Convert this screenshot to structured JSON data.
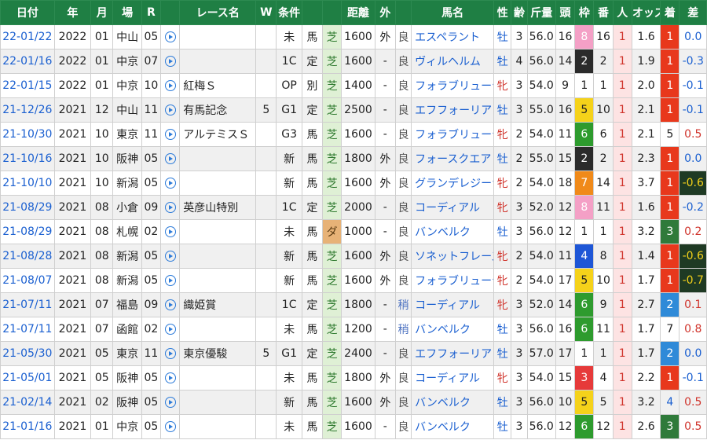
{
  "headers": [
    "日付",
    "年",
    "月",
    "場",
    "R",
    "",
    "レース名",
    "W",
    "条件",
    "",
    "",
    "距離",
    "外",
    "",
    "馬名",
    "性",
    "齢",
    "斤量",
    "頭",
    "枠",
    "番",
    "人",
    "オッズ",
    "着",
    "差"
  ],
  "rows": [
    {
      "date": "22-01/22",
      "year": "2022",
      "month": "01",
      "venue": "中山",
      "r": "05",
      "race": "",
      "w": "",
      "cond": "未",
      "cond2": "馬",
      "surface": "芝",
      "dist": "1600",
      "out": "外",
      "track": "良",
      "horse": "エスペラント",
      "sex": "牡",
      "age": "3",
      "weight": "56.0",
      "heads": "16",
      "frame": "8",
      "num": "16",
      "pop": "1",
      "odds": "1.6",
      "rank": "1",
      "diff": "0.0"
    },
    {
      "date": "22-01/16",
      "year": "2022",
      "month": "01",
      "venue": "中京",
      "r": "07",
      "race": "",
      "w": "",
      "cond": "1C",
      "cond2": "定",
      "surface": "芝",
      "dist": "1600",
      "out": "-",
      "track": "良",
      "horse": "ヴィルヘルム",
      "sex": "牡",
      "age": "4",
      "weight": "56.0",
      "heads": "14",
      "frame": "2",
      "num": "2",
      "pop": "1",
      "odds": "1.9",
      "rank": "1",
      "diff": "-0.3"
    },
    {
      "date": "22-01/15",
      "year": "2022",
      "month": "01",
      "venue": "中京",
      "r": "10",
      "race": "紅梅Ｓ",
      "w": "",
      "cond": "OP",
      "cond2": "別",
      "surface": "芝",
      "dist": "1400",
      "out": "-",
      "track": "良",
      "horse": "フォラブリューテ",
      "sex": "牝",
      "age": "3",
      "weight": "54.0",
      "heads": "9",
      "frame": "1",
      "num": "1",
      "pop": "1",
      "odds": "2.0",
      "rank": "1",
      "diff": "-0.1"
    },
    {
      "date": "21-12/26",
      "year": "2021",
      "month": "12",
      "venue": "中山",
      "r": "11",
      "race": "有馬記念",
      "w": "5",
      "cond": "G1",
      "cond2": "定",
      "surface": "芝",
      "dist": "2500",
      "out": "-",
      "track": "良",
      "horse": "エフフォーリア",
      "sex": "牡",
      "age": "3",
      "weight": "55.0",
      "heads": "16",
      "frame": "5",
      "num": "10",
      "pop": "1",
      "odds": "2.1",
      "rank": "1",
      "diff": "-0.1"
    },
    {
      "date": "21-10/30",
      "year": "2021",
      "month": "10",
      "venue": "東京",
      "r": "11",
      "race": "アルテミスＳ",
      "w": "",
      "cond": "G3",
      "cond2": "馬",
      "surface": "芝",
      "dist": "1600",
      "out": "-",
      "track": "良",
      "horse": "フォラブリューテ",
      "sex": "牝",
      "age": "2",
      "weight": "54.0",
      "heads": "11",
      "frame": "6",
      "num": "6",
      "pop": "1",
      "odds": "2.1",
      "rank": "5",
      "diff": "0.5"
    },
    {
      "date": "21-10/16",
      "year": "2021",
      "month": "10",
      "venue": "阪神",
      "r": "05",
      "race": "",
      "w": "",
      "cond": "新",
      "cond2": "馬",
      "surface": "芝",
      "dist": "1800",
      "out": "外",
      "track": "良",
      "horse": "フォースクエア",
      "sex": "牡",
      "age": "2",
      "weight": "55.0",
      "heads": "15",
      "frame": "2",
      "num": "2",
      "pop": "1",
      "odds": "2.3",
      "rank": "1",
      "diff": "0.0"
    },
    {
      "date": "21-10/10",
      "year": "2021",
      "month": "10",
      "venue": "新潟",
      "r": "05",
      "race": "",
      "w": "",
      "cond": "新",
      "cond2": "馬",
      "surface": "芝",
      "dist": "1600",
      "out": "外",
      "track": "良",
      "horse": "グランデレジーナ",
      "sex": "牝",
      "age": "2",
      "weight": "54.0",
      "heads": "18",
      "frame": "7",
      "num": "14",
      "pop": "1",
      "odds": "3.7",
      "rank": "1",
      "diff": "-0.6"
    },
    {
      "date": "21-08/29",
      "year": "2021",
      "month": "08",
      "venue": "小倉",
      "r": "09",
      "race": "英彦山特別",
      "w": "",
      "cond": "1C",
      "cond2": "定",
      "surface": "芝",
      "dist": "2000",
      "out": "-",
      "track": "良",
      "horse": "コーディアル",
      "sex": "牝",
      "age": "3",
      "weight": "52.0",
      "heads": "12",
      "frame": "8",
      "num": "11",
      "pop": "1",
      "odds": "1.6",
      "rank": "1",
      "diff": "-0.2"
    },
    {
      "date": "21-08/29",
      "year": "2021",
      "month": "08",
      "venue": "札幌",
      "r": "02",
      "race": "",
      "w": "",
      "cond": "未",
      "cond2": "馬",
      "surface": "ダ",
      "dist": "1000",
      "out": "-",
      "track": "良",
      "horse": "バンベルク",
      "sex": "牡",
      "age": "3",
      "weight": "56.0",
      "heads": "12",
      "frame": "1",
      "num": "1",
      "pop": "1",
      "odds": "3.2",
      "rank": "3",
      "diff": "0.2"
    },
    {
      "date": "21-08/28",
      "year": "2021",
      "month": "08",
      "venue": "新潟",
      "r": "05",
      "race": "",
      "w": "",
      "cond": "新",
      "cond2": "馬",
      "surface": "芝",
      "dist": "1600",
      "out": "外",
      "track": "良",
      "horse": "ソネットフレーズ",
      "sex": "牝",
      "age": "2",
      "weight": "54.0",
      "heads": "11",
      "frame": "4",
      "num": "8",
      "pop": "1",
      "odds": "1.4",
      "rank": "1",
      "diff": "-0.6"
    },
    {
      "date": "21-08/07",
      "year": "2021",
      "month": "08",
      "venue": "新潟",
      "r": "05",
      "race": "",
      "w": "",
      "cond": "新",
      "cond2": "馬",
      "surface": "芝",
      "dist": "1600",
      "out": "外",
      "track": "良",
      "horse": "フォラブリューテ",
      "sex": "牝",
      "age": "2",
      "weight": "54.0",
      "heads": "17",
      "frame": "5",
      "num": "10",
      "pop": "1",
      "odds": "1.7",
      "rank": "1",
      "diff": "-0.7"
    },
    {
      "date": "21-07/11",
      "year": "2021",
      "month": "07",
      "venue": "福島",
      "r": "09",
      "race": "織姫賞",
      "w": "",
      "cond": "1C",
      "cond2": "定",
      "surface": "芝",
      "dist": "1800",
      "out": "-",
      "track": "稍",
      "horse": "コーディアル",
      "sex": "牝",
      "age": "3",
      "weight": "52.0",
      "heads": "14",
      "frame": "6",
      "num": "9",
      "pop": "1",
      "odds": "2.7",
      "rank": "2",
      "diff": "0.1"
    },
    {
      "date": "21-07/11",
      "year": "2021",
      "month": "07",
      "venue": "函館",
      "r": "02",
      "race": "",
      "w": "",
      "cond": "未",
      "cond2": "馬",
      "surface": "芝",
      "dist": "1200",
      "out": "-",
      "track": "稍",
      "horse": "バンベルク",
      "sex": "牡",
      "age": "3",
      "weight": "56.0",
      "heads": "16",
      "frame": "6",
      "num": "11",
      "pop": "1",
      "odds": "1.7",
      "rank": "7",
      "diff": "0.8"
    },
    {
      "date": "21-05/30",
      "year": "2021",
      "month": "05",
      "venue": "東京",
      "r": "11",
      "race": "東京優駿",
      "w": "5",
      "cond": "G1",
      "cond2": "定",
      "surface": "芝",
      "dist": "2400",
      "out": "-",
      "track": "良",
      "horse": "エフフォーリア",
      "sex": "牡",
      "age": "3",
      "weight": "57.0",
      "heads": "17",
      "frame": "1",
      "num": "1",
      "pop": "1",
      "odds": "1.7",
      "rank": "2",
      "diff": "0.0"
    },
    {
      "date": "21-05/01",
      "year": "2021",
      "month": "05",
      "venue": "阪神",
      "r": "05",
      "race": "",
      "w": "",
      "cond": "未",
      "cond2": "馬",
      "surface": "芝",
      "dist": "1800",
      "out": "外",
      "track": "良",
      "horse": "コーディアル",
      "sex": "牝",
      "age": "3",
      "weight": "54.0",
      "heads": "15",
      "frame": "3",
      "num": "4",
      "pop": "1",
      "odds": "2.2",
      "rank": "1",
      "diff": "-0.1"
    },
    {
      "date": "21-02/14",
      "year": "2021",
      "month": "02",
      "venue": "阪神",
      "r": "05",
      "race": "",
      "w": "",
      "cond": "新",
      "cond2": "馬",
      "surface": "芝",
      "dist": "1600",
      "out": "外",
      "track": "良",
      "horse": "バンベルク",
      "sex": "牡",
      "age": "3",
      "weight": "56.0",
      "heads": "10",
      "frame": "5",
      "num": "5",
      "pop": "1",
      "odds": "3.2",
      "rank": "4",
      "diff": "0.5"
    },
    {
      "date": "21-01/16",
      "year": "2021",
      "month": "01",
      "venue": "中京",
      "r": "05",
      "race": "",
      "w": "",
      "cond": "未",
      "cond2": "馬",
      "surface": "芝",
      "dist": "1600",
      "out": "-",
      "track": "良",
      "horse": "バンベルク",
      "sex": "牡",
      "age": "3",
      "weight": "56.0",
      "heads": "12",
      "frame": "6",
      "num": "12",
      "pop": "1",
      "odds": "2.6",
      "rank": "3",
      "diff": "0.5"
    }
  ],
  "frame_colors": {
    "1": "#ffffff",
    "2": "#2b2b2b",
    "3": "#e63a3a",
    "4": "#1e56d6",
    "5": "#f5d21a",
    "6": "#2e9b2e",
    "7": "#f08a1a",
    "8": "#f4a0c6"
  },
  "rank_colors": {
    "1": "#e8381c",
    "2": "#2f8ad8",
    "3": "#2f7a3a"
  }
}
